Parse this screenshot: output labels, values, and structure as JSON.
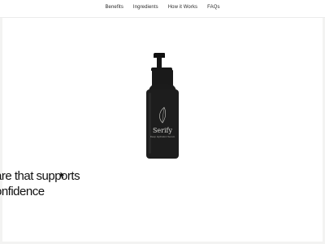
{
  "nav": {
    "links": [
      "Benefits",
      "Ingredients",
      "How it Works",
      "FAQs"
    ]
  },
  "product": {
    "brand": "Serify",
    "subtitle": "Deep Hydration Serum",
    "icon": "leaf-icon"
  },
  "hero": {
    "line1": "are that supports",
    "line2": "onfidence"
  },
  "colors": {
    "background": "#ffffff",
    "text": "#111111",
    "bottle": "#1d1d1d",
    "label_text": "#d9d9d6"
  },
  "icons": {
    "cursor": "arrow-cursor-icon"
  }
}
